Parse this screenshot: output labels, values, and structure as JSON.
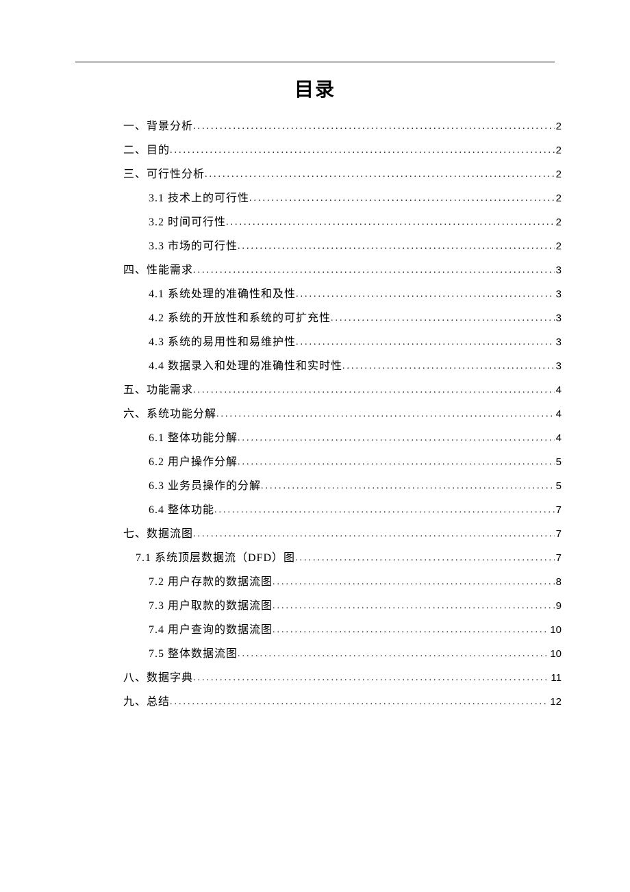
{
  "title": "目录",
  "toc": [
    {
      "level": 1,
      "label": "一、背景分析",
      "page": "2"
    },
    {
      "level": 1,
      "label": "二、目的",
      "page": "2"
    },
    {
      "level": 1,
      "label": "三、可行性分析",
      "page": "2"
    },
    {
      "level": 2,
      "label": "3.1 技术上的可行性",
      "page": "2"
    },
    {
      "level": 2,
      "label": "3.2 时间可行性",
      "page": "2"
    },
    {
      "level": 2,
      "label": "3.3  市场的可行性",
      "page": "2"
    },
    {
      "level": 1,
      "label": "四、性能需求",
      "page": "3"
    },
    {
      "level": 2,
      "label": "4.1 系统处理的准确性和及性",
      "page": "3"
    },
    {
      "level": 2,
      "label": "4.2 系统的开放性和系统的可扩充性",
      "page": "3"
    },
    {
      "level": 2,
      "label": "4.3  系统的易用性和易维护性",
      "page": "3"
    },
    {
      "level": 2,
      "label": "4.4 数据录入和处理的准确性和实时性",
      "page": "3"
    },
    {
      "level": 1,
      "label": "五、功能需求",
      "page": "4"
    },
    {
      "level": 1,
      "label": "六、系统功能分解",
      "page": "4"
    },
    {
      "level": 2,
      "label": "6.1 整体功能分解",
      "page": "4"
    },
    {
      "level": 2,
      "label": "6.2 用户操作分解",
      "page": "5"
    },
    {
      "level": 2,
      "label": "6.3 业务员操作的分解",
      "page": "5"
    },
    {
      "level": 2,
      "label": "6.4 整体功能",
      "page": "7"
    },
    {
      "level": 1,
      "label": "七、数据流图",
      "page": "7"
    },
    {
      "level": "2b",
      "label": "7.1 系统顶层数据流（DFD）图 ",
      "page": "7"
    },
    {
      "level": 2,
      "label": "7.2 用户存款的数据流图",
      "page": "8"
    },
    {
      "level": 2,
      "label": "7.3 用户取款的数据流图",
      "page": "9"
    },
    {
      "level": 2,
      "label": "7.4 用户查询的数据流图",
      "page": "10"
    },
    {
      "level": 2,
      "label": "7.5 整体数据流图",
      "page": "10"
    },
    {
      "level": 1,
      "label": "八、数据字典",
      "page": "11"
    },
    {
      "level": 1,
      "label": "九、总结",
      "page": "12"
    }
  ]
}
